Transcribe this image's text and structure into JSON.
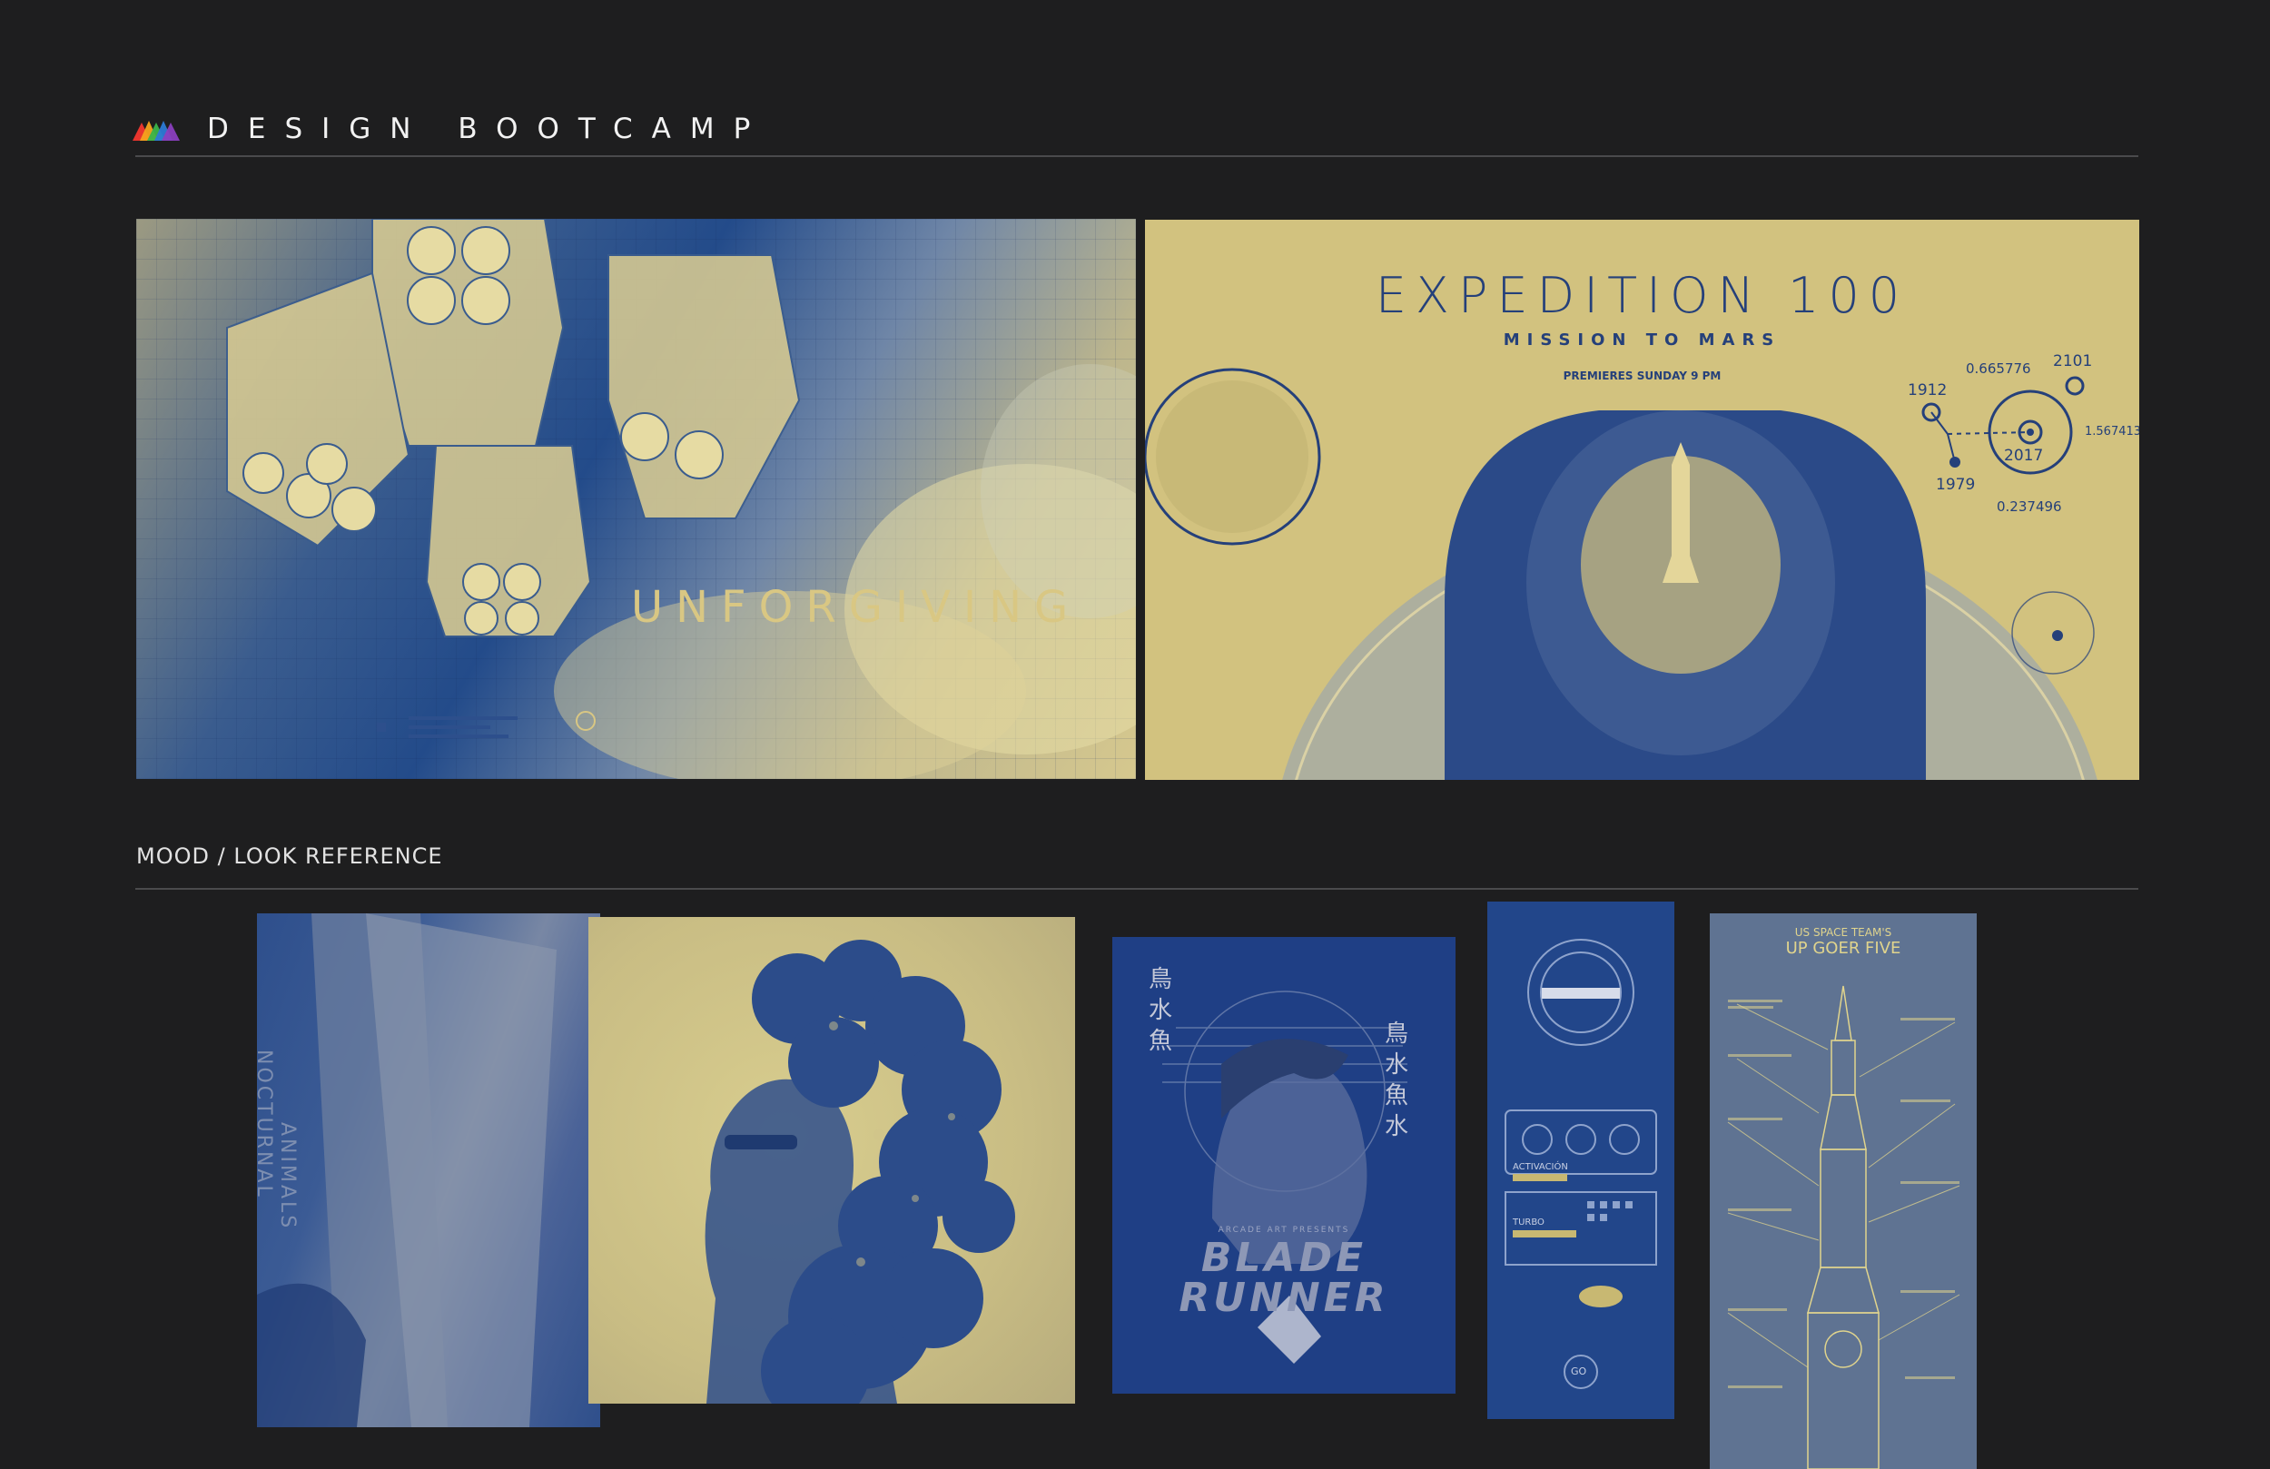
{
  "header": {
    "title": "DESIGN BOOTCAMP",
    "logo_colors": [
      "#e8352e",
      "#f6a31d",
      "#3bb54a",
      "#2c7ad6",
      "#8b3fbf"
    ]
  },
  "hero": {
    "left": {
      "word": "UNFORGIVING"
    },
    "right": {
      "title": "EXPEDITION 100",
      "subtitle": "MISSION TO MARS",
      "premieres": "PREMIERES SUNDAY 9 PM",
      "orbit_labels": [
        "0.665776",
        "2101",
        "1912",
        "1.567413",
        "2017",
        "1979",
        "0.237496"
      ]
    }
  },
  "section": {
    "title": "MOOD / LOOK REFERENCE"
  },
  "mood": {
    "nocturnal": {
      "title_line1": "NOCTURNAL",
      "title_line2": "ANIMALS"
    },
    "blade": {
      "presents": "ARCADE ART PRESENTS",
      "line1": "BLADE",
      "line2": "RUNNER",
      "kanji_left": [
        "鳥",
        "水",
        "魚"
      ],
      "kanji_right": [
        "鳥",
        "水",
        "魚",
        "水"
      ]
    },
    "dash": {
      "label1": "ACTIVACIÓN",
      "label2": "TURBO",
      "go": "GO"
    },
    "blueprint": {
      "line1": "US SPACE TEAM'S",
      "line2": "UP GOER FIVE"
    }
  },
  "colors": {
    "background": "#1e1e1f",
    "navy": "#25407a",
    "sand": "#d2c27f"
  }
}
